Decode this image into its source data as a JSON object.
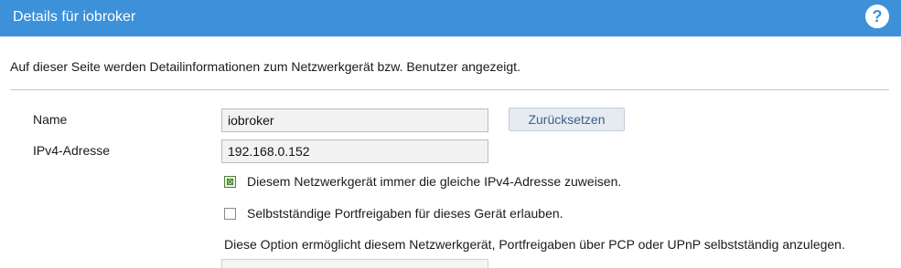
{
  "header": {
    "title": "Details für iobroker",
    "help_icon": "help-icon",
    "help_glyph": "?",
    "color": "#3c91d9"
  },
  "intro": "Auf dieser Seite werden Detailinformationen zum Netzwerkgerät bzw. Benutzer angezeigt.",
  "form": {
    "name_label": "Name",
    "name_value": "iobroker",
    "reset_label": "Zurücksetzen",
    "ipv4_label": "IPv4-Adresse",
    "ipv4_value": "192.168.0.152",
    "same_ip_label": "Diesem Netzwerkgerät immer die gleiche IPv4-Adresse zuweisen.",
    "same_ip_checked": true,
    "port_sharing_label": "Selbstständige Portfreigaben für dieses Gerät erlauben.",
    "port_sharing_checked": false,
    "port_sharing_note": "Diese Option ermöglicht diesem Netzwerkgerät, Portfreigaben über PCP oder UPnP selbstständig anzulegen."
  }
}
